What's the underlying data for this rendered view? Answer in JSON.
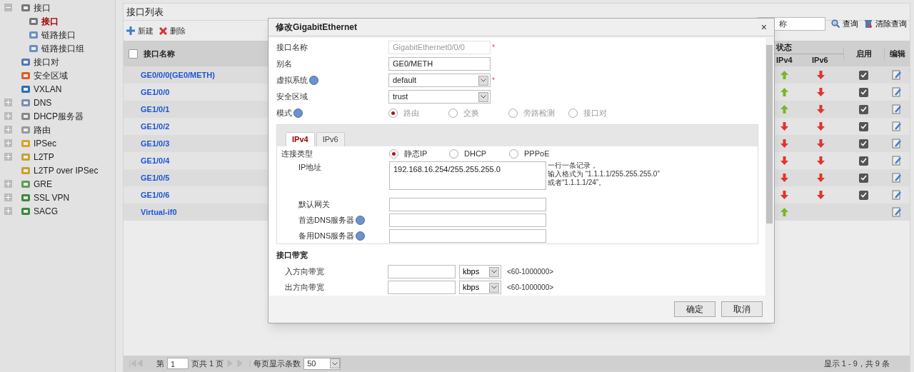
{
  "sidebar": {
    "items": [
      {
        "label": "接口",
        "expanded": true,
        "children": [
          {
            "label": "接口",
            "selected": true
          },
          {
            "label": "链路接口",
            "selected": false
          },
          {
            "label": "链路接口组",
            "selected": false
          }
        ]
      },
      {
        "label": "接口对"
      },
      {
        "label": "安全区域"
      },
      {
        "label": "VXLAN"
      },
      {
        "label": "DNS",
        "expanded": false
      },
      {
        "label": "DHCP服务器",
        "expanded": false
      },
      {
        "label": "路由",
        "expanded": false
      },
      {
        "label": "IPSec",
        "expanded": false
      },
      {
        "label": "L2TP",
        "expanded": false
      },
      {
        "label": "L2TP over IPSec"
      },
      {
        "label": "GRE",
        "expanded": false
      },
      {
        "label": "SSL VPN",
        "expanded": false
      },
      {
        "label": "SACG",
        "expanded": false
      }
    ]
  },
  "panel": {
    "title": "接口列表",
    "toolbar": [
      {
        "label": "新建",
        "kind": "add"
      },
      {
        "label": "删除",
        "kind": "delete"
      }
    ],
    "search": {
      "value": "称"
    },
    "search_button": "查询",
    "clear_button": "清除查询",
    "table": {
      "select_all": {
        "checked": false
      },
      "columns": {
        "name": "接口名称",
        "status": "状态",
        "ipv4": "IPv4",
        "ipv6": "IPv6",
        "enable": "启用",
        "edit": "编辑"
      },
      "rows": [
        {
          "name": "GE0/0/0(GE0/METH)",
          "ipv4_up": true,
          "ipv6_up": false,
          "enabled": true
        },
        {
          "name": "GE1/0/0",
          "ipv4_up": true,
          "ipv6_up": false,
          "enabled": true
        },
        {
          "name": "GE1/0/1",
          "ipv4_up": true,
          "ipv6_up": false,
          "enabled": true
        },
        {
          "name": "GE1/0/2",
          "ipv4_up": false,
          "ipv6_up": false,
          "enabled": true
        },
        {
          "name": "GE1/0/3",
          "ipv4_up": false,
          "ipv6_up": false,
          "enabled": true
        },
        {
          "name": "GE1/0/4",
          "ipv4_up": false,
          "ipv6_up": false,
          "enabled": true
        },
        {
          "name": "GE1/0/5",
          "ipv4_up": false,
          "ipv6_up": false,
          "enabled": true
        },
        {
          "name": "GE1/0/6",
          "ipv4_up": false,
          "ipv6_up": false,
          "enabled": true
        },
        {
          "name": "Virtual-if0",
          "ipv4_up": true
        }
      ]
    },
    "pager": {
      "page_prefix": "第",
      "page": "1",
      "page_suffix": "页共 1 页",
      "per_page_label": "每页显示条数",
      "per_page": "50",
      "summary": "显示 1 - 9，共 9 条"
    }
  },
  "dialog": {
    "title": "修改GigabitEthernet",
    "close": "×",
    "fields": [
      {
        "label": "接口名称",
        "kind": "text",
        "value": "GigabitEthernet0/0/0",
        "disabled": true,
        "required_mark": "*"
      },
      {
        "label": "别名",
        "kind": "text",
        "value": "GE0/METH",
        "disabled": false
      },
      {
        "label": "虚拟系统",
        "kind": "select",
        "help": true,
        "value": "default",
        "required_mark": "*"
      },
      {
        "label": "安全区域",
        "kind": "select",
        "value": "trust"
      },
      {
        "label": "模式",
        "kind": "radio",
        "help": true,
        "disabled": true,
        "options": [
          {
            "label": "路由",
            "selected": true
          },
          {
            "label": "交换",
            "selected": false
          },
          {
            "label": "旁路检测",
            "selected": false
          },
          {
            "label": "接口对",
            "selected": false
          }
        ]
      }
    ],
    "tabs": [
      {
        "label": "IPv4",
        "selected": true
      },
      {
        "label": "IPv6",
        "selected": false
      }
    ],
    "connection": {
      "label": "连接类型",
      "options": [
        {
          "label": "静态IP",
          "selected": true
        },
        {
          "label": "DHCP",
          "selected": false
        },
        {
          "label": "PPPoE",
          "selected": false
        }
      ]
    },
    "ip_fields": [
      {
        "label": "IP地址",
        "kind": "textarea",
        "value": "192.168.16.254/255.255.255.0",
        "hint": [
          "一行一条记录，",
          "输入格式为 “1.1.1.1/255.255.255.0”",
          "或者“1.1.1.1/24”。"
        ]
      },
      {
        "label": "默认网关",
        "kind": "text"
      },
      {
        "label": "首选DNS服务器",
        "kind": "text",
        "help": true
      },
      {
        "label": "备用DNS服务器",
        "kind": "text",
        "help": true
      }
    ],
    "bandwidth": {
      "title": "接口带宽",
      "rows": [
        {
          "label": "入方向带宽",
          "unit": "kbps",
          "range": "<60-1000000>"
        },
        {
          "label": "出方向带宽",
          "unit": "kbps",
          "range": "<60-1000000>"
        }
      ]
    },
    "buttons": [
      "确定",
      "取消"
    ]
  }
}
